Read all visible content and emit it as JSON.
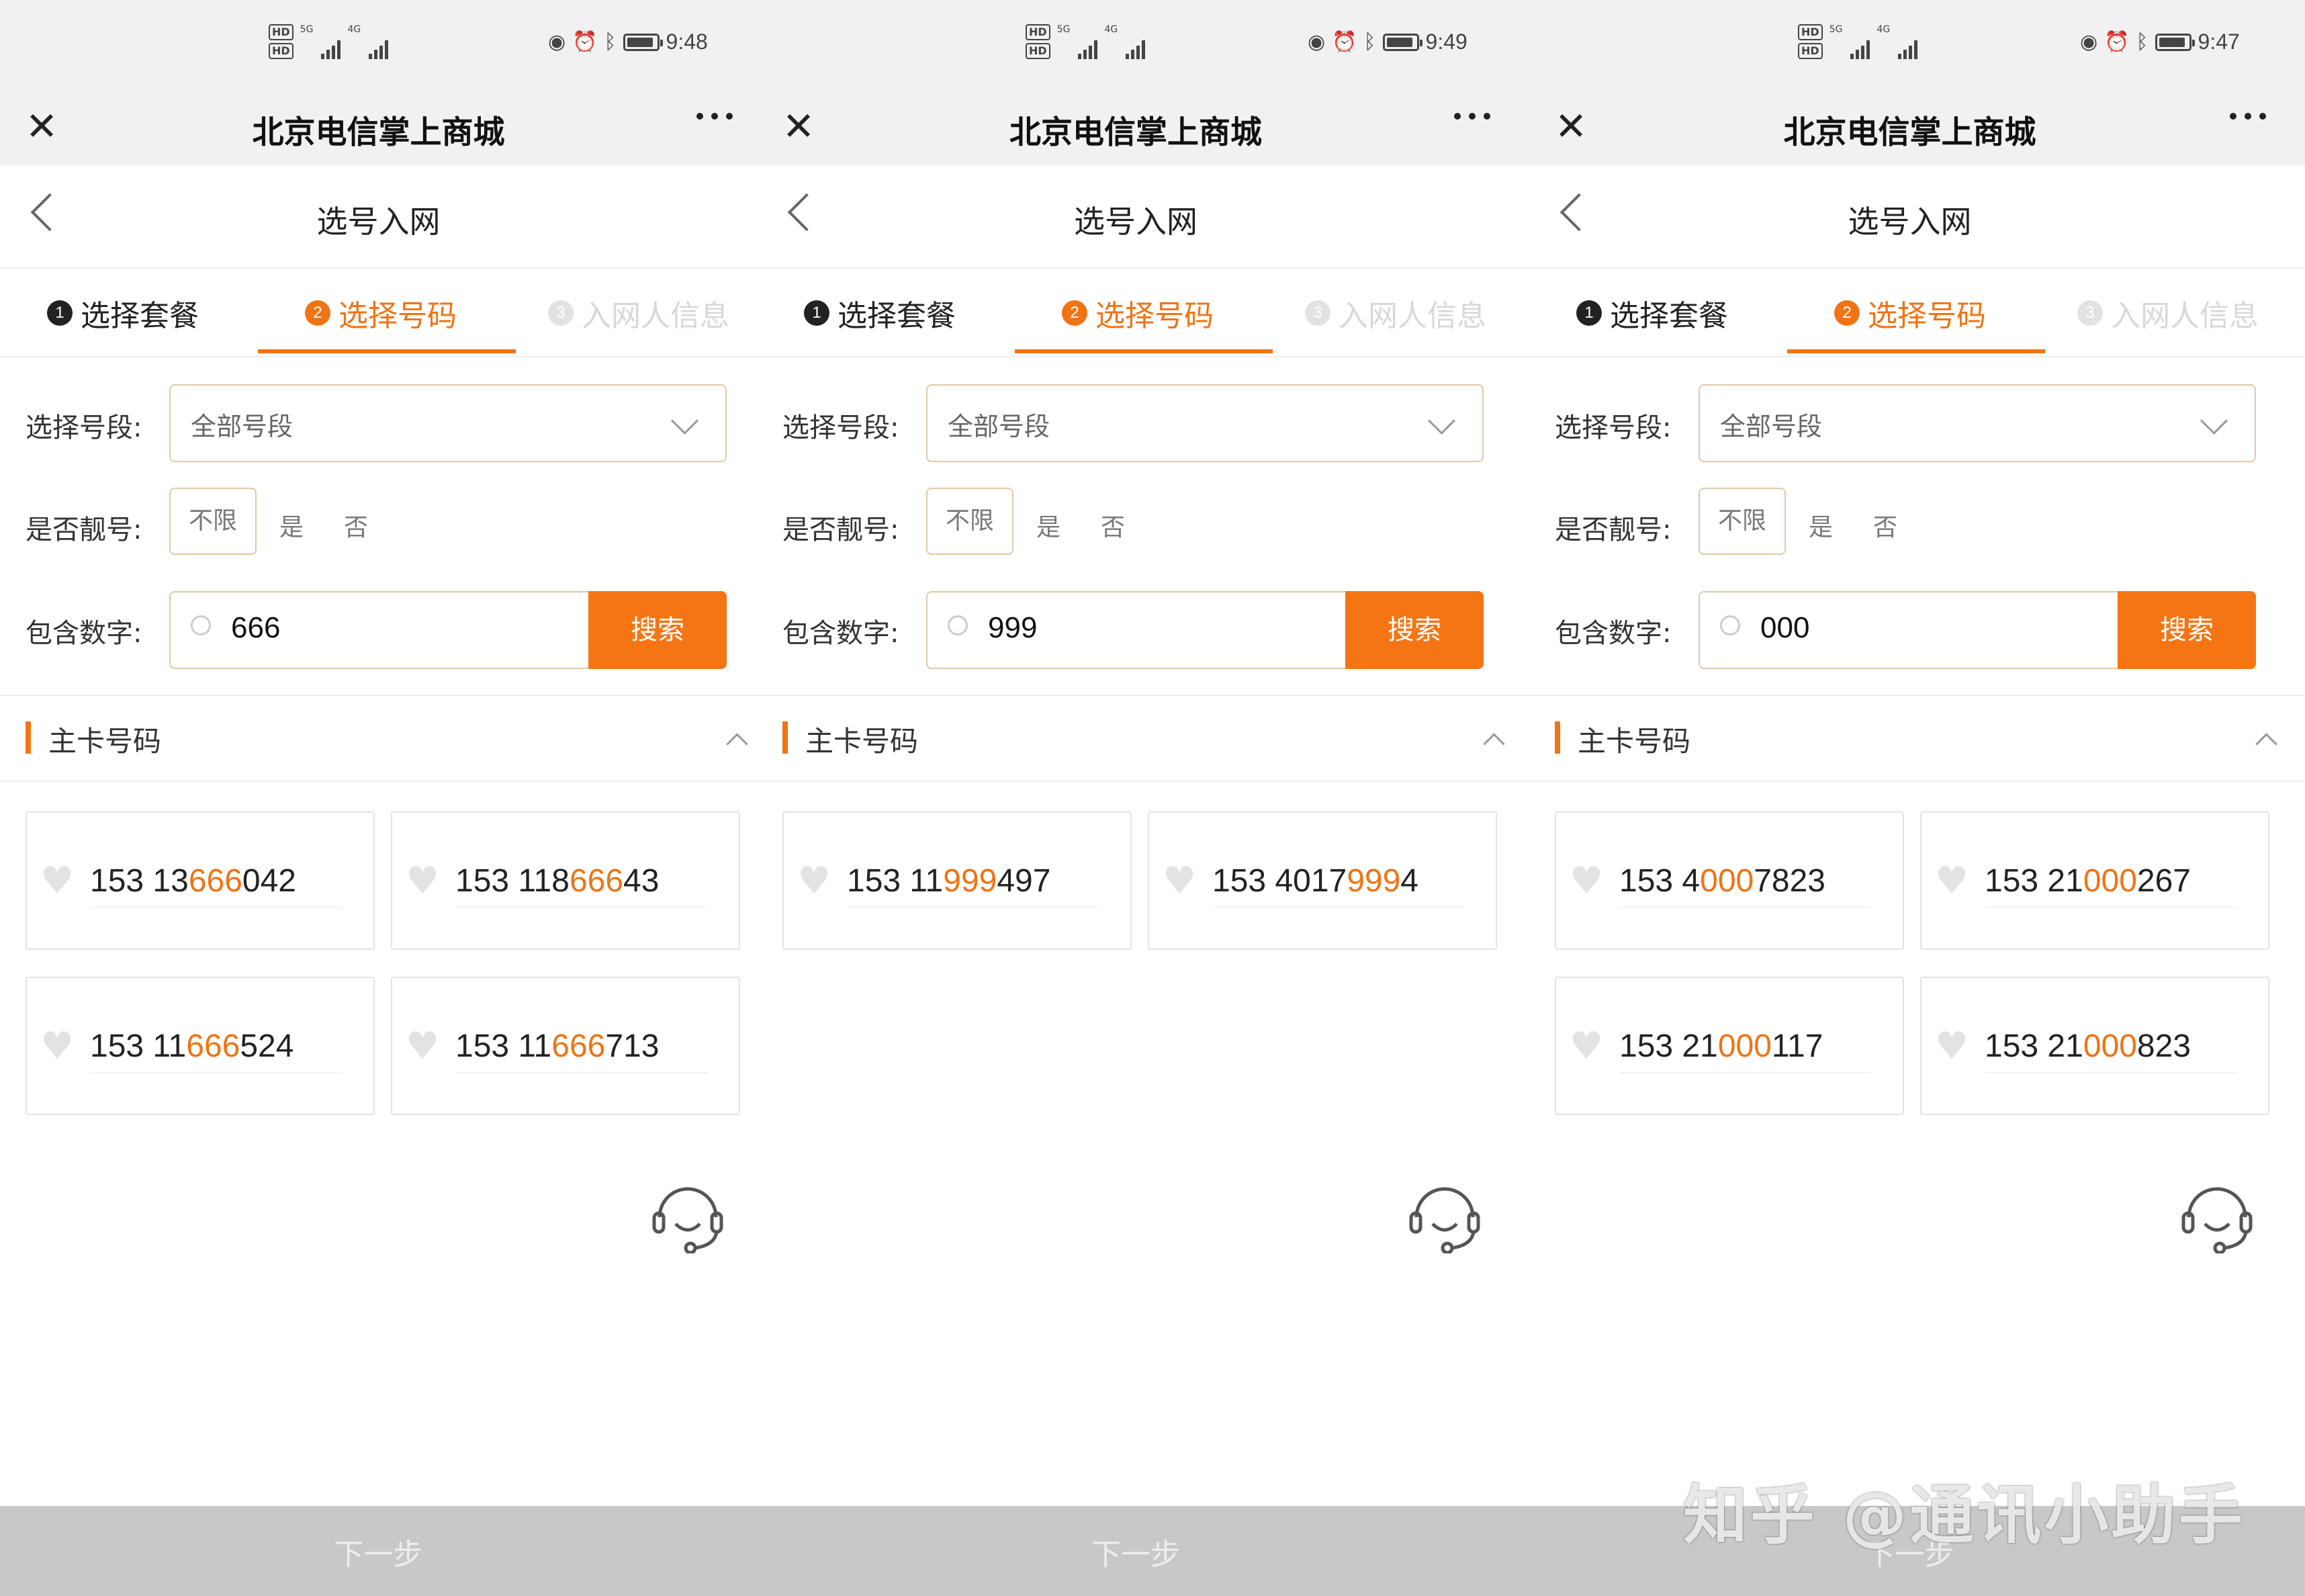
{
  "status_times": [
    "9:48",
    "9:49",
    "9:47"
  ],
  "status": {
    "hd1": "HD",
    "hd2": "HD",
    "net1": "5G",
    "net2": "4G"
  },
  "app_title": "北京电信掌上商城",
  "page_title": "选号入网",
  "steps": [
    {
      "num": "1",
      "label": "选择套餐"
    },
    {
      "num": "2",
      "label": "选择号码"
    },
    {
      "num": "3",
      "label": "入网人信息"
    }
  ],
  "form": {
    "segment_label": "选择号段:",
    "segment_value": "全部号段",
    "pretty_label": "是否靓号:",
    "pretty_options": [
      "不限",
      "是",
      "否"
    ],
    "contains_label": "包含数字:",
    "search_button": "搜索"
  },
  "queries": [
    "666",
    "999",
    "000"
  ],
  "section_title": "主卡号码",
  "next_button": "下一步",
  "numbers": [
    [
      {
        "pre": "153 13",
        "hl": "666",
        "post": "042"
      },
      {
        "pre": "153 118",
        "hl": "666",
        "post": "43"
      },
      {
        "pre": "153 11",
        "hl": "666",
        "post": "524"
      },
      {
        "pre": "153 11",
        "hl": "666",
        "post": "713"
      }
    ],
    [
      {
        "pre": "153 11",
        "hl": "999",
        "post": "497"
      },
      {
        "pre": "153 4017",
        "hl": "999",
        "post": "4"
      }
    ],
    [
      {
        "pre": "153 4",
        "hl": "000",
        "post": "7823"
      },
      {
        "pre": "153 21",
        "hl": "000",
        "post": "267"
      },
      {
        "pre": "153 21",
        "hl": "000",
        "post": "117"
      },
      {
        "pre": "153 21",
        "hl": "000",
        "post": "823"
      }
    ]
  ],
  "watermark": "知乎 @通讯小助手",
  "colors": {
    "accent": "#f07414",
    "search_button": "#f57514",
    "status_bar": "#f1f1f1"
  }
}
